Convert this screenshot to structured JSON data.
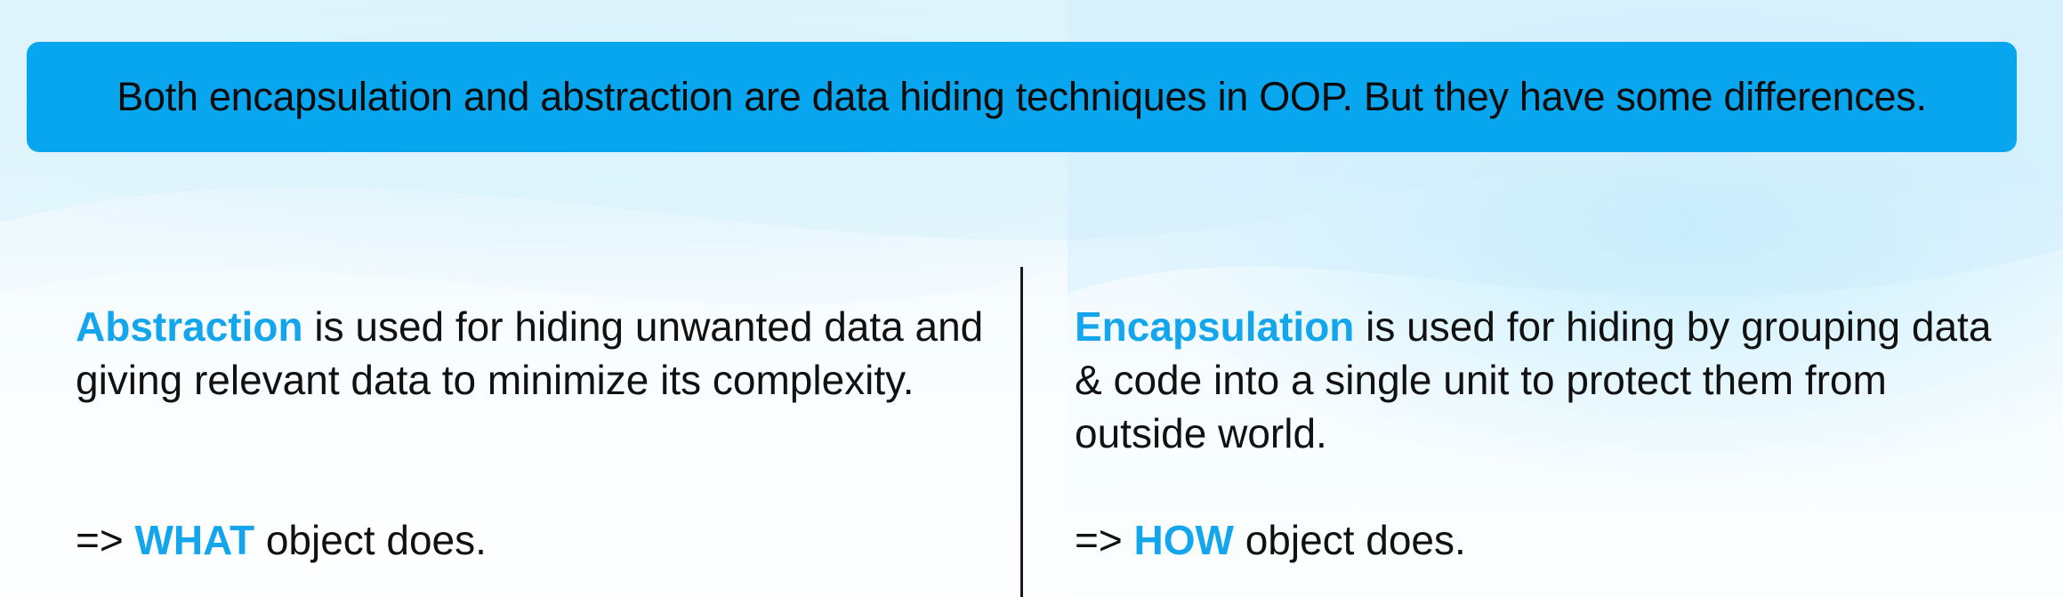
{
  "banner": {
    "text": "Both encapsulation and abstraction are data hiding techniques in OOP. But they have some differences."
  },
  "left": {
    "term": "Abstraction",
    "definition": " is used for hiding unwanted data and giving relevant data to minimize its complexity.",
    "arrow": "=> ",
    "keyword": "WHAT",
    "tail": " object does."
  },
  "right": {
    "term": "Encapsulation",
    "definition": " is used for hiding by grouping data & code into a single unit to protect them from outside world.",
    "arrow": "=> ",
    "keyword": "HOW",
    "tail": " object does."
  },
  "colors": {
    "banner_bg": "#08a6ef",
    "accent": "#14a6ec",
    "text": "#111111"
  }
}
